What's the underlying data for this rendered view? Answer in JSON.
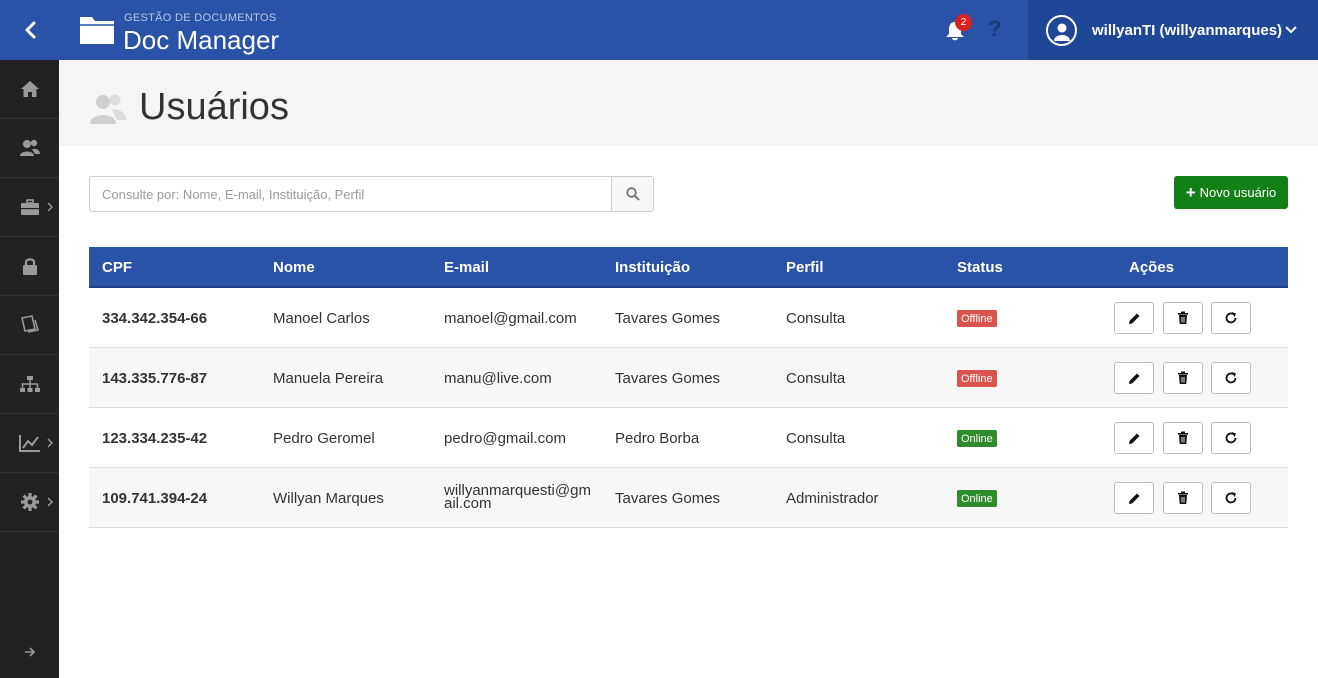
{
  "header": {
    "subtitle": "GESTÃO DE DOCUMENTOS",
    "title": "Doc Manager",
    "notification_count": "2",
    "help_label": "?",
    "user_name": "willyanTI (willyanmarques)"
  },
  "sidebar": {
    "items": [
      {
        "icon": "home-icon"
      },
      {
        "icon": "users-icon"
      },
      {
        "icon": "briefcase-icon"
      },
      {
        "icon": "lock-icon"
      },
      {
        "icon": "documents-icon"
      },
      {
        "icon": "org-chart-icon"
      },
      {
        "icon": "chart-icon"
      },
      {
        "icon": "gear-icon"
      }
    ]
  },
  "page": {
    "title": "Usuários"
  },
  "search": {
    "placeholder": "Consulte por: Nome, E-mail, Instituição, Perfil"
  },
  "new_button": {
    "label": "Novo usuário"
  },
  "table": {
    "headers": [
      "CPF",
      "Nome",
      "E-mail",
      "Instituição",
      "Perfil",
      "Status",
      "Ações"
    ],
    "rows": [
      {
        "cpf": "334.342.354-66",
        "nome": "Manoel Carlos",
        "email": "manoel@gmail.com",
        "instituicao": "Tavares Gomes",
        "perfil": "Consulta",
        "status": "Offline"
      },
      {
        "cpf": "143.335.776-87",
        "nome": "Manuela Pereira",
        "email": "manu@live.com",
        "instituicao": "Tavares Gomes",
        "perfil": "Consulta",
        "status": "Offline"
      },
      {
        "cpf": "123.334.235-42",
        "nome": "Pedro Geromel",
        "email": "pedro@gmail.com",
        "instituicao": "Pedro Borba",
        "perfil": "Consulta",
        "status": "Online"
      },
      {
        "cpf": "109.741.394-24",
        "nome": "Willyan Marques",
        "email": "willyanmarquesti@gmail.com",
        "instituicao": "Tavares Gomes",
        "perfil": "Administrador",
        "status": "Online"
      }
    ]
  },
  "colors": {
    "primary": "#2a52a6",
    "sidebar": "#222222",
    "success": "#128016",
    "offline": "#d9534f",
    "online": "#2e8b2e"
  }
}
